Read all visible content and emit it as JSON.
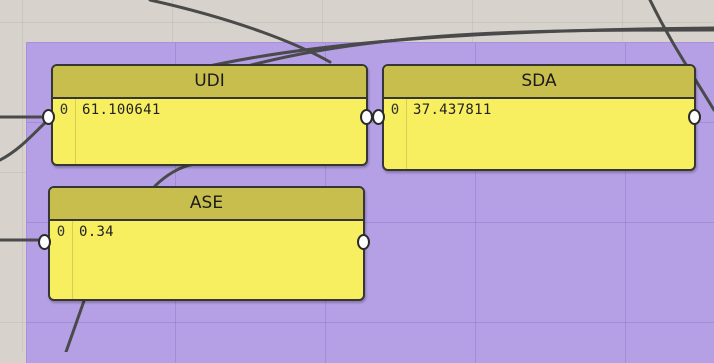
{
  "panels": [
    {
      "title": "UDI",
      "index": "0",
      "value": "61.100641"
    },
    {
      "title": "SDA",
      "index": "0",
      "value": "37.437811"
    },
    {
      "title": "ASE",
      "index": "0",
      "value": "0.34"
    }
  ],
  "colors": {
    "canvas": "#d7d3cc",
    "group": "#b5a0e6",
    "panel_fill": "#f8ef60",
    "panel_header": "#c8be4d",
    "wire": "#4a4a4a"
  }
}
